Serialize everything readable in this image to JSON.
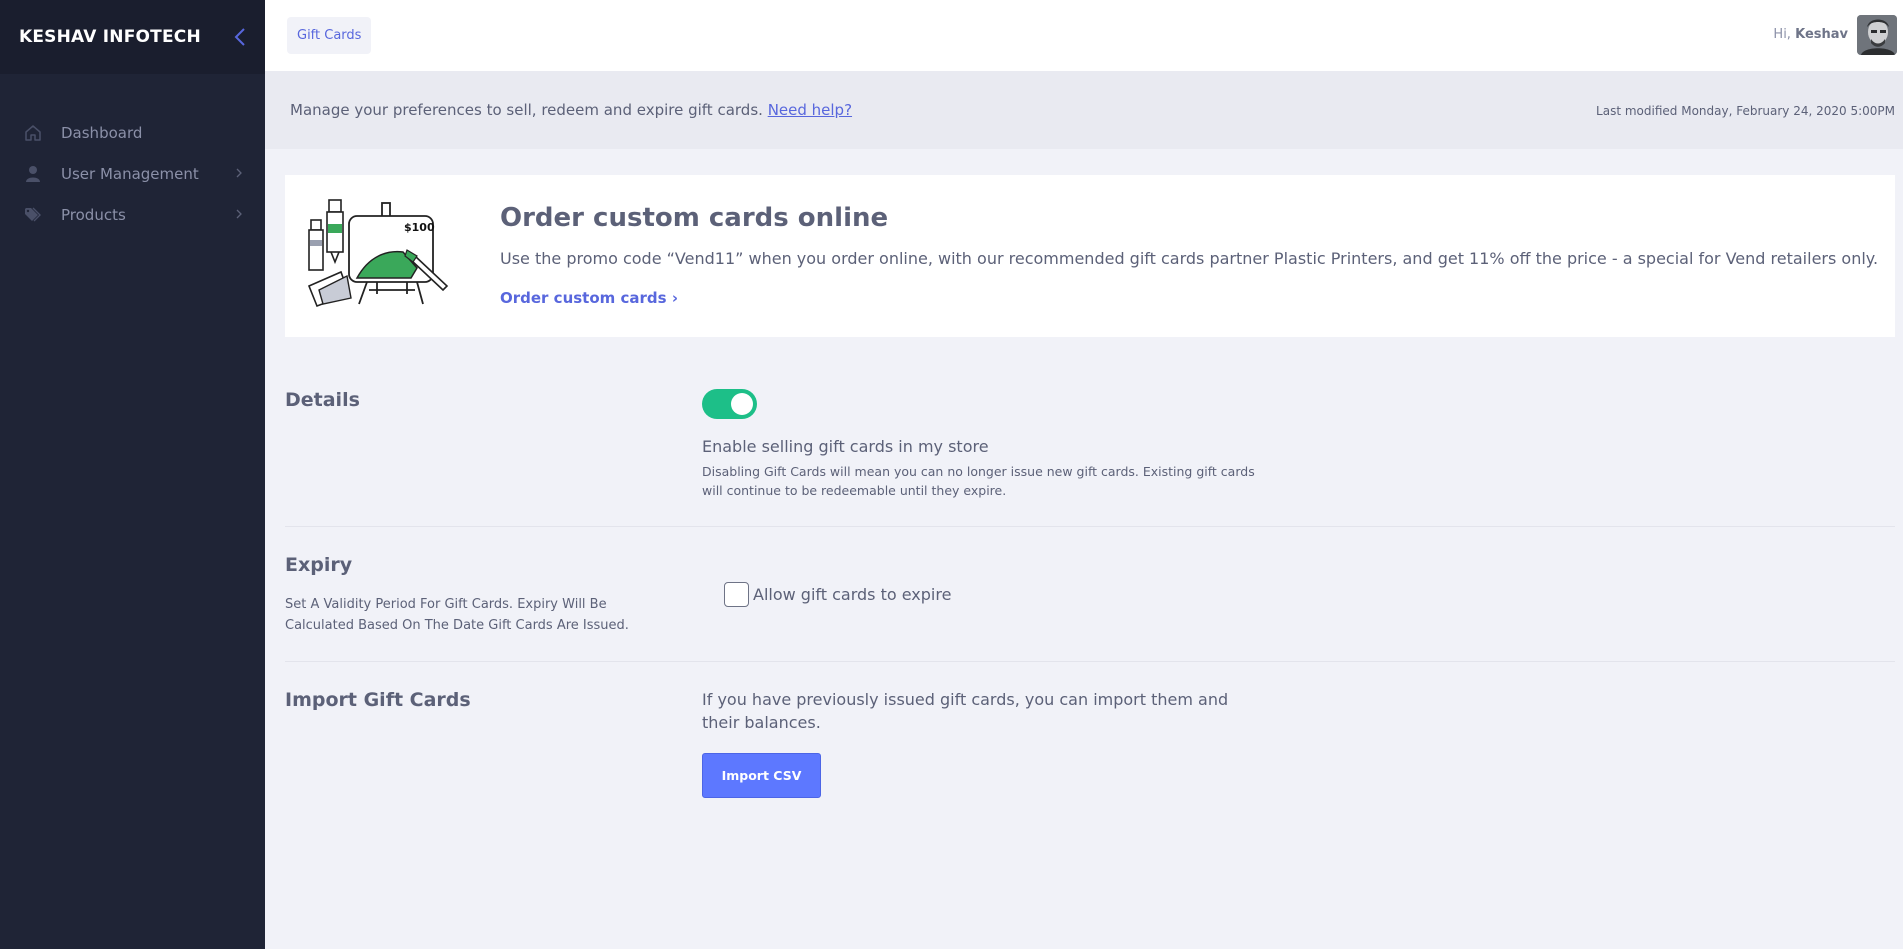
{
  "sidebar": {
    "brand": "KESHAV INFOTECH",
    "items": [
      {
        "label": "Dashboard",
        "icon": "home-icon"
      },
      {
        "label": "User Management",
        "icon": "user-icon"
      },
      {
        "label": "Products",
        "icon": "tags-icon"
      }
    ]
  },
  "header": {
    "breadcrumb": "Gift Cards",
    "greeting": "Hi,",
    "user_name": "Keshav"
  },
  "subheader": {
    "text": "Manage your preferences to sell, redeem and expire gift cards.",
    "help_link": "Need help?",
    "last_modified": "Last modified Monday, February 24, 2020 5:00PM"
  },
  "promo": {
    "title": "Order custom cards online",
    "description": "Use the promo code “Vend11” when you order online, with our recommended gift cards partner Plastic Printers, and get 11% off the price - a special for Vend retailers only.",
    "link": "Order custom cards",
    "art_price": "$100"
  },
  "details": {
    "title": "Details",
    "toggle_on": true,
    "option_title": "Enable selling gift cards in my store",
    "option_desc": "Disabling Gift Cards will mean you can no longer issue new gift cards. Existing gift cards will continue to be redeemable until they expire."
  },
  "expiry": {
    "title": "Expiry",
    "desc": "Set A Validity Period For Gift Cards. Expiry Will Be Calculated Based On The Date Gift Cards Are Issued.",
    "checkbox_label": "Allow gift cards to expire",
    "checked": false
  },
  "import": {
    "title": "Import Gift Cards",
    "desc": "If you have previously issued gift cards, you can import them and their balances.",
    "button": "Import CSV"
  },
  "colors": {
    "sidebar_bg": "#1f2436",
    "accent": "#5867dd",
    "toggle_on": "#1dbf88",
    "button": "#5d78ff"
  }
}
